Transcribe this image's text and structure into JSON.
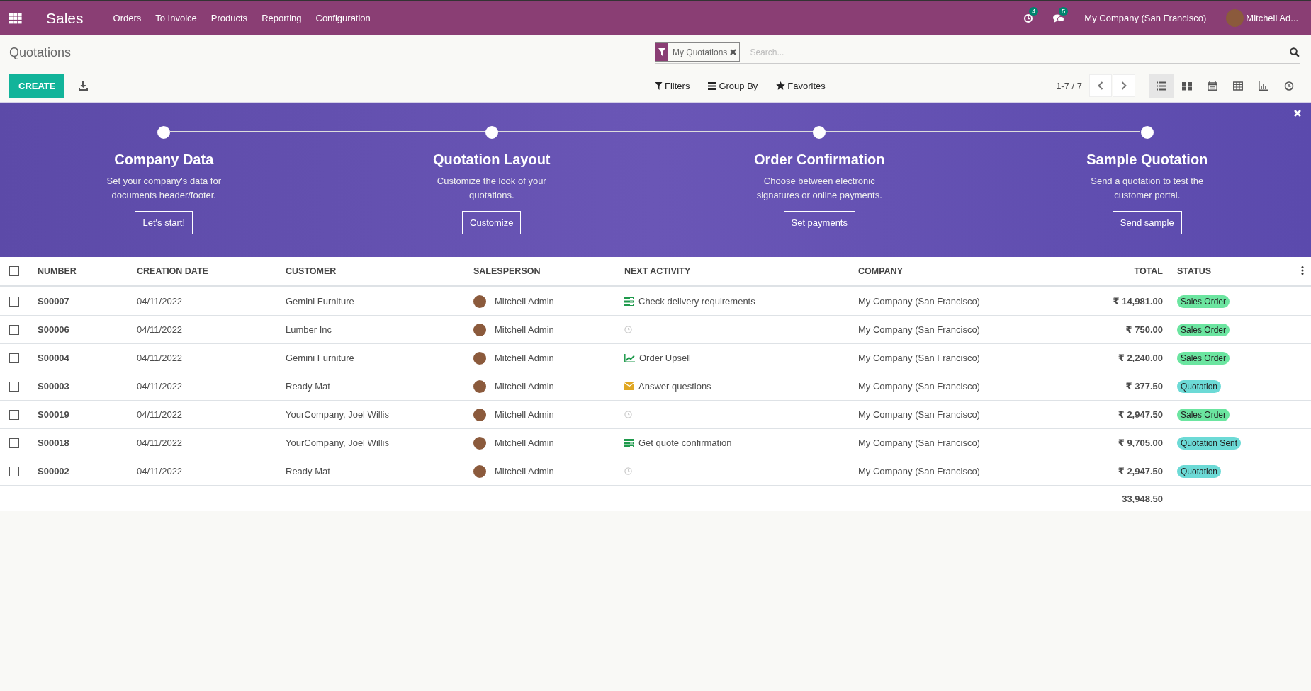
{
  "navbar": {
    "app_name": "Sales",
    "menu": [
      "Orders",
      "To Invoice",
      "Products",
      "Reporting",
      "Configuration"
    ],
    "activity_count": "4",
    "message_count": "5",
    "company": "My Company (San Francisco)",
    "user": "Mitchell Ad..."
  },
  "control_panel": {
    "title": "Quotations",
    "create_button": "CREATE",
    "facet": "My Quotations",
    "search": {
      "placeholder": "Search..."
    },
    "filters": "Filters",
    "group_by": "Group By",
    "favorites": "Favorites",
    "pager": "1-7 / 7",
    "views": [
      {
        "kind": "list",
        "selected": true
      },
      {
        "kind": "kanban",
        "selected": false
      },
      {
        "kind": "calendar",
        "selected": false
      },
      {
        "kind": "pivot",
        "selected": false
      },
      {
        "kind": "graph",
        "selected": false
      },
      {
        "kind": "activity",
        "selected": false
      }
    ]
  },
  "onboarding": {
    "steps": [
      {
        "title": "Company Data",
        "text": "Set your company's data for documents header/footer.",
        "button": "Let's start!"
      },
      {
        "title": "Quotation Layout",
        "text": "Customize the look of your quotations.",
        "button": "Customize"
      },
      {
        "title": "Order Confirmation",
        "text": "Choose between electronic signatures or online payments.",
        "button": "Set payments"
      },
      {
        "title": "Sample Quotation",
        "text": "Send a quotation to test the customer portal.",
        "button": "Send sample"
      }
    ]
  },
  "table": {
    "select_all_checked": false,
    "columns": [
      "NUMBER",
      "CREATION DATE",
      "CUSTOMER",
      "SALESPERSON",
      "NEXT ACTIVITY",
      "COMPANY",
      "TOTAL",
      "STATUS"
    ],
    "rows": [
      {
        "checked": false,
        "number": "S00007",
        "date": "04/11/2022",
        "customer": "Gemini Furniture",
        "salesperson": "Mitchell Admin",
        "activity": {
          "kind": "todo",
          "text": "Check delivery requirements"
        },
        "company": "My Company (San Francisco)",
        "total": "₹ 14,981.00",
        "status": {
          "text": "Sales Order",
          "color": "#6be5a0"
        }
      },
      {
        "checked": false,
        "number": "S00006",
        "date": "04/11/2022",
        "customer": "Lumber Inc",
        "salesperson": "Mitchell Admin",
        "activity": {
          "kind": "none"
        },
        "company": "My Company (San Francisco)",
        "total": "₹ 750.00",
        "status": {
          "text": "Sales Order",
          "color": "#6be5a0"
        }
      },
      {
        "checked": false,
        "number": "S00004",
        "date": "04/11/2022",
        "customer": "Gemini Furniture",
        "salesperson": "Mitchell Admin",
        "activity": {
          "kind": "upsell",
          "text": "Order Upsell"
        },
        "company": "My Company (San Francisco)",
        "total": "₹ 2,240.00",
        "status": {
          "text": "Sales Order",
          "color": "#6be5a0"
        }
      },
      {
        "checked": false,
        "number": "S00003",
        "date": "04/11/2022",
        "customer": "Ready Mat",
        "salesperson": "Mitchell Admin",
        "activity": {
          "kind": "email",
          "text": "Answer questions"
        },
        "company": "My Company (San Francisco)",
        "total": "₹ 377.50",
        "status": {
          "text": "Quotation",
          "color": "#6cdad6"
        }
      },
      {
        "checked": false,
        "number": "S00019",
        "date": "04/11/2022",
        "customer": "YourCompany, Joel Willis",
        "salesperson": "Mitchell Admin",
        "activity": {
          "kind": "none"
        },
        "company": "My Company (San Francisco)",
        "total": "₹ 2,947.50",
        "status": {
          "text": "Sales Order",
          "color": "#6be5a0"
        }
      },
      {
        "checked": false,
        "number": "S00018",
        "date": "04/11/2022",
        "customer": "YourCompany, Joel Willis",
        "salesperson": "Mitchell Admin",
        "activity": {
          "kind": "todo",
          "text": "Get quote confirmation"
        },
        "company": "My Company (San Francisco)",
        "total": "₹ 9,705.00",
        "status": {
          "text": "Quotation Sent",
          "color": "#6cdad6"
        }
      },
      {
        "checked": false,
        "number": "S00002",
        "date": "04/11/2022",
        "customer": "Ready Mat",
        "salesperson": "Mitchell Admin",
        "activity": {
          "kind": "none"
        },
        "company": "My Company (San Francisco)",
        "total": "₹ 2,947.50",
        "status": {
          "text": "Quotation",
          "color": "#6cdad6"
        }
      }
    ],
    "grand_total": "33,948.50"
  }
}
